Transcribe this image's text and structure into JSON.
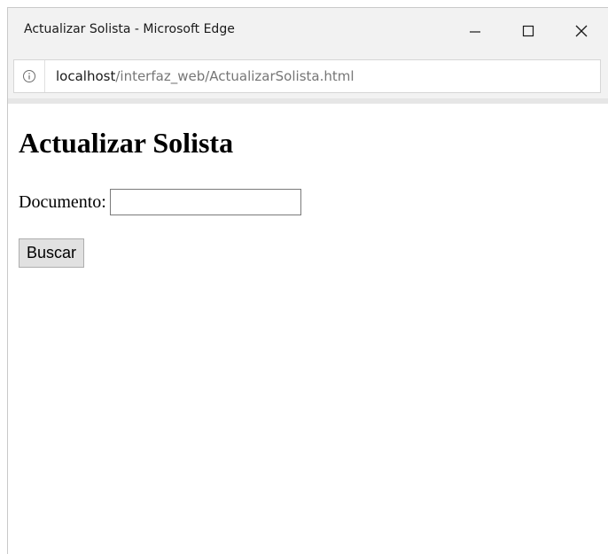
{
  "window": {
    "title": "Actualizar Solista - Microsoft Edge",
    "controls": {
      "minimize_icon": "minimize-icon",
      "maximize_icon": "maximize-icon",
      "close_icon": "close-icon"
    }
  },
  "addressbar": {
    "info_icon": "info-icon",
    "url_host": "localhost",
    "url_path": "/interfaz_web/ActualizarSolista.html"
  },
  "page": {
    "heading": "Actualizar Solista",
    "documento_label": "Documento:",
    "documento_value": "",
    "buscar_label": "Buscar"
  },
  "colors": {
    "titlebar_bg": "#f2f2f2",
    "url_path": "#767676",
    "button_bg": "#e1e1e1"
  }
}
